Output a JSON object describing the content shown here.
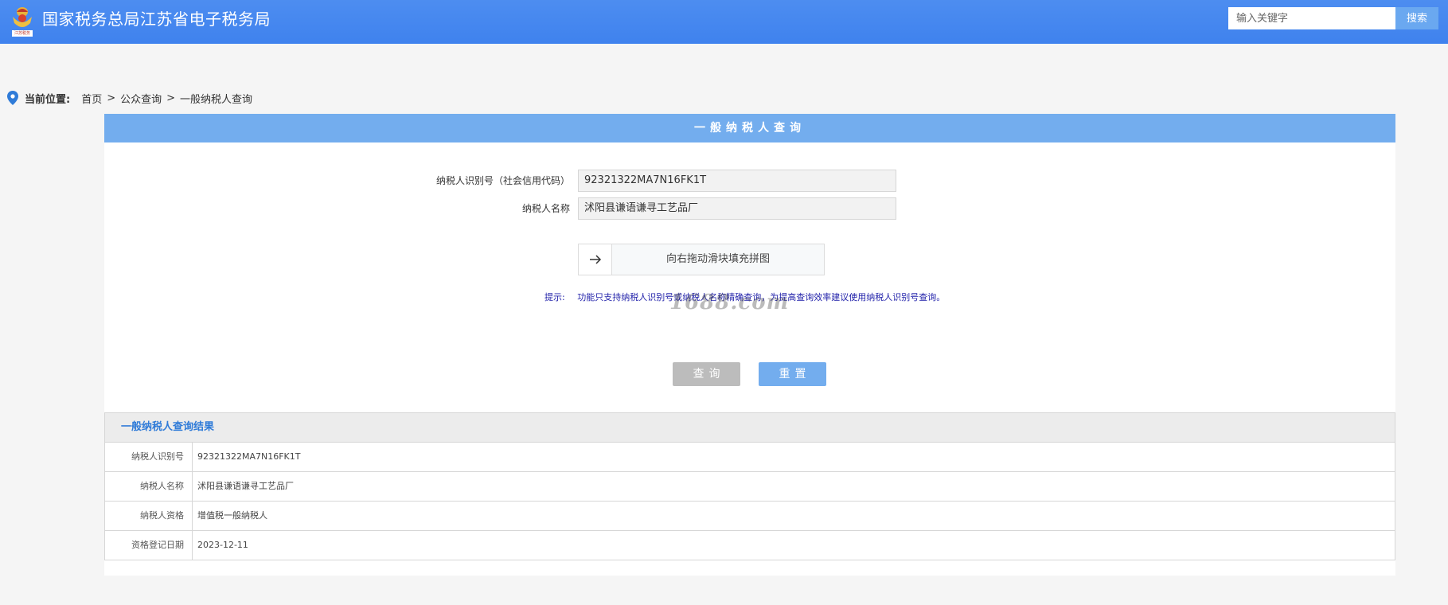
{
  "header": {
    "title": "国家税务总局江苏省电子税务局",
    "logo_text": "江苏税务",
    "search_placeholder": "输入关键字",
    "search_button": "搜索"
  },
  "breadcrumb": {
    "label": "当前位置:",
    "items": [
      "首页",
      "公众查询",
      "一般纳税人查询"
    ],
    "separator": ">"
  },
  "query": {
    "title": "一般纳税人查询",
    "fields": [
      {
        "label": "纳税人识别号（社会信用代码）",
        "value": "92321322MA7N16FK1T"
      },
      {
        "label": "纳税人名称",
        "value": "沭阳县谦语谦寻工艺品厂"
      }
    ],
    "slider_text": "向右拖动滑块填充拼图",
    "hint_label": "提示:",
    "hint_text": "功能只支持纳税人识别号或纳税人名称精确查询，为提高查询效率建议使用纳税人识别号查询。",
    "query_button": "查询",
    "reset_button": "重置"
  },
  "watermark": "1688.com",
  "results": {
    "title": "一般纳税人查询结果",
    "rows": [
      {
        "key": "纳税人识别号",
        "value": "92321322MA7N16FK1T"
      },
      {
        "key": "纳税人名称",
        "value": "沭阳县谦语谦寻工艺品厂"
      },
      {
        "key": "纳税人资格",
        "value": "增值税一般纳税人"
      },
      {
        "key": "资格登记日期",
        "value": "2023-12-11"
      }
    ]
  },
  "colors": {
    "header_blue": "#3f82ee",
    "panel_header_blue": "#73adee",
    "result_title_blue": "#2f7bd8",
    "hint_blue": "#2222aa"
  },
  "icons": {
    "logo": "tax-emblem-icon",
    "breadcrumb": "location-pin-icon",
    "slider": "arrow-right-icon"
  }
}
